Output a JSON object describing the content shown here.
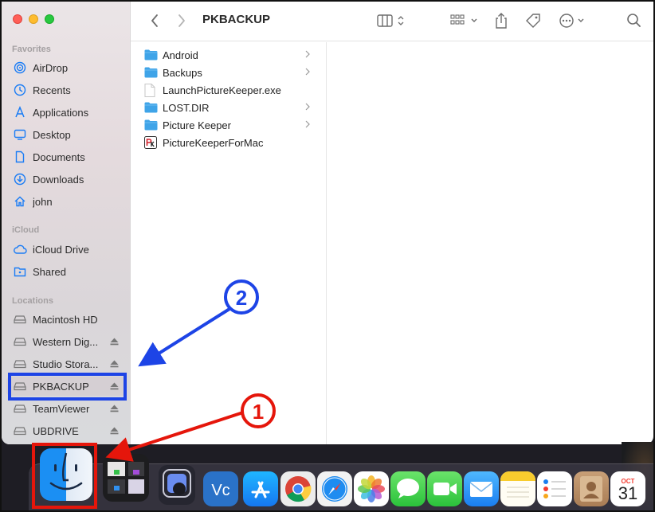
{
  "window": {
    "title": "PKBACKUP"
  },
  "sidebar": {
    "sections": [
      {
        "title": "Favorites"
      },
      {
        "title": "iCloud"
      },
      {
        "title": "Locations"
      }
    ],
    "favorites": [
      {
        "label": "AirDrop",
        "icon": "airdrop-icon"
      },
      {
        "label": "Recents",
        "icon": "clock-icon"
      },
      {
        "label": "Applications",
        "icon": "applications-icon"
      },
      {
        "label": "Desktop",
        "icon": "desktop-icon"
      },
      {
        "label": "Documents",
        "icon": "document-icon"
      },
      {
        "label": "Downloads",
        "icon": "download-icon"
      },
      {
        "label": "john",
        "icon": "home-icon"
      }
    ],
    "icloud": [
      {
        "label": "iCloud Drive",
        "icon": "cloud-icon"
      },
      {
        "label": "Shared",
        "icon": "shared-folder-icon"
      }
    ],
    "locations": [
      {
        "label": "Macintosh HD",
        "icon": "drive-icon",
        "eject": false
      },
      {
        "label": "Western Dig...",
        "icon": "drive-icon",
        "eject": true
      },
      {
        "label": "Studio Stora...",
        "icon": "drive-icon",
        "eject": true
      },
      {
        "label": "PKBACKUP",
        "icon": "drive-icon",
        "eject": true,
        "selected": true
      },
      {
        "label": "TeamViewer",
        "icon": "drive-icon",
        "eject": true
      },
      {
        "label": "UBDRIVE",
        "icon": "drive-icon",
        "eject": true
      }
    ]
  },
  "files": [
    {
      "name": "Android",
      "type": "folder",
      "has_children": true
    },
    {
      "name": "Backups",
      "type": "folder",
      "has_children": true
    },
    {
      "name": "LaunchPictureKeeper.exe",
      "type": "file",
      "has_children": false
    },
    {
      "name": "LOST.DIR",
      "type": "folder",
      "has_children": true
    },
    {
      "name": "Picture Keeper",
      "type": "folder",
      "has_children": true
    },
    {
      "name": "PictureKeeperForMac",
      "type": "app",
      "has_children": false
    }
  ],
  "annotations": {
    "step1": "1",
    "step2": "2",
    "arrow_red": "#e5160b",
    "arrow_blue": "#1d44e6"
  },
  "dock": {
    "calendar_month": "OCT",
    "calendar_day": "31",
    "apps": [
      "finder-icon",
      "mission-control-icon",
      "screenshot-icon",
      "vnc-viewer-icon",
      "app-store-icon",
      "chrome-icon",
      "safari-icon",
      "photos-icon",
      "messages-icon",
      "facetime-icon",
      "mail-icon",
      "notes-icon",
      "reminders-icon",
      "contacts-icon",
      "calendar-icon"
    ]
  },
  "colors": {
    "folder_blue": "#3fa4e8",
    "accent_blue": "#1a7cf5"
  }
}
